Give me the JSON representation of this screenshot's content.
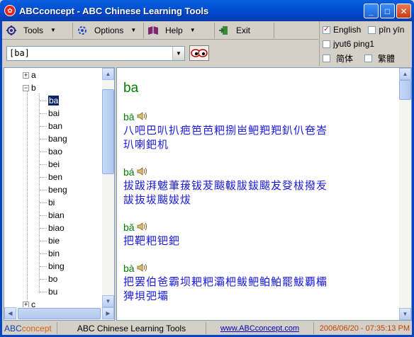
{
  "window": {
    "app_name": "ABCconcept",
    "title_separator": " - ",
    "title_rest": "ABC Chinese Learning Tools",
    "minimize": "_",
    "maximize": "□",
    "close": "✕"
  },
  "toolbar": {
    "tools_label": "Tools",
    "options_label": "Options",
    "help_label": "Help",
    "exit_label": "Exit"
  },
  "options": {
    "english_label": "English",
    "english_checked": true,
    "pinyin_label": "pīn yīn",
    "pinyin_checked": false,
    "jyutping_label": "jyut6 ping1",
    "jyutping_checked": false,
    "simplified_label": "简体",
    "simplified_checked": false,
    "traditional_label": "繁體",
    "traditional_checked": false
  },
  "search": {
    "value": "[ba]"
  },
  "tree": {
    "letter_a": "a",
    "letter_b": "b",
    "letter_c": "c",
    "children": [
      "ba",
      "bai",
      "ban",
      "bang",
      "bao",
      "bei",
      "ben",
      "beng",
      "bi",
      "bian",
      "biao",
      "bie",
      "bin",
      "bing",
      "bo",
      "bu"
    ],
    "selected": "ba"
  },
  "content": {
    "heading": "ba",
    "entries": [
      {
        "pinyin": "bā",
        "line1": "八吧巴叭扒疤笆芭粑捌岜鲃羓羓釟仈夿峇",
        "line2": "玐喇鈀机"
      },
      {
        "pinyin": "bá",
        "line1": "拔跋湃魃茟菝钹茇颰軷胈鈸颰犮癹柭撥叐",
        "line2": "詙抜坺颰妭炦"
      },
      {
        "pinyin": "bǎ",
        "line1": "把靶粑钯鈀",
        "line2": ""
      },
      {
        "pinyin": "bà",
        "line1": "把罢伯爸霸坝耙粑灞杷鲅鲃鲌鮊罷鮁覇欛",
        "line2": "猈垻弝壩"
      }
    ]
  },
  "statusbar": {
    "brand_abc": "ABC",
    "brand_concept": "concept",
    "title": "ABC Chinese Learning Tools",
    "url": "www.ABCconcept.com",
    "datetime": "2006/06/20 - 07:35:13 PM"
  },
  "colors": {
    "titlebar": "#0054e3",
    "pinyin_green": "#008000",
    "chars_blue": "#1a1adb",
    "selection": "#0a246a"
  }
}
